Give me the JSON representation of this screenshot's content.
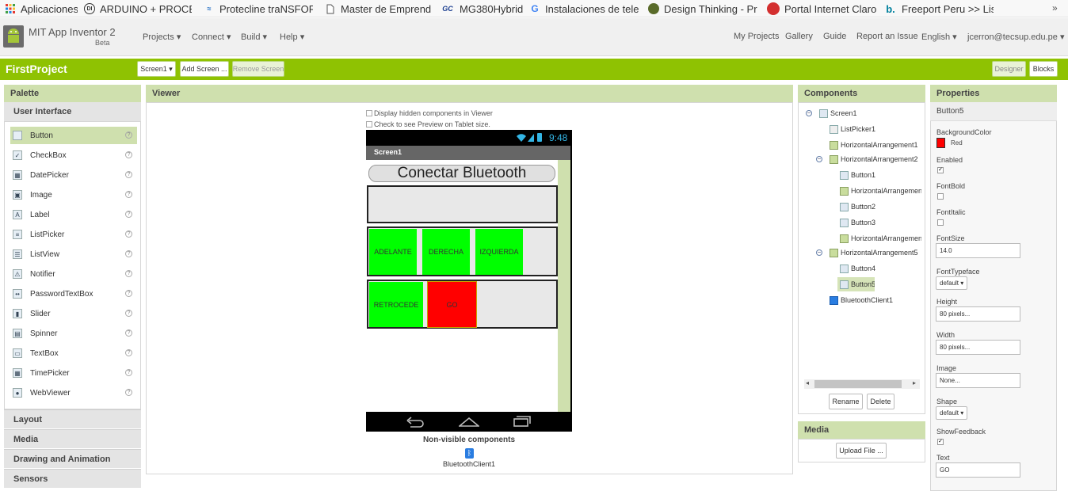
{
  "bookmarks": [
    {
      "label": "Aplicaciones",
      "icon": "apps-grid-icon"
    },
    {
      "label": "ARDUINO + PROCES",
      "icon": "di-logo-icon",
      "badge": "DI"
    },
    {
      "label": "Protecline traNSFORM",
      "icon": "protecline-icon"
    },
    {
      "label": "Master de Emprende",
      "icon": "document-icon"
    },
    {
      "label": "MG380Hybrid",
      "icon": "gc-logo-icon",
      "badge": "GC"
    },
    {
      "label": "Instalaciones de telec",
      "icon": "google-icon",
      "badge": "G"
    },
    {
      "label": "Design Thinking - Pro",
      "icon": "design-thinking-icon"
    },
    {
      "label": "Portal Internet Claro",
      "icon": "claro-icon"
    },
    {
      "label": "Freeport Peru >> List",
      "icon": "bing-icon",
      "badge": "b."
    }
  ],
  "app": {
    "logo_title": "MIT App Inventor 2",
    "logo_subtitle": "Beta",
    "menus": [
      "Projects",
      "Connect",
      "Build",
      "Help"
    ],
    "right_links": [
      "My Projects",
      "Gallery",
      "Guide",
      "Report an Issue",
      "English",
      "jcerron@tecsup.edu.pe"
    ]
  },
  "project": {
    "name": "FirstProject",
    "screen_select": "Screen1",
    "add_screen": "Add Screen ...",
    "remove_screen": "Remove Screen",
    "designer": "Designer",
    "blocks": "Blocks"
  },
  "palette": {
    "title": "Palette",
    "open_category": "User Interface",
    "items": [
      "Button",
      "CheckBox",
      "DatePicker",
      "Image",
      "Label",
      "ListPicker",
      "ListView",
      "Notifier",
      "PasswordTextBox",
      "Slider",
      "Spinner",
      "TextBox",
      "TimePicker",
      "WebViewer"
    ],
    "help_mark": "?",
    "categories": [
      "Layout",
      "Media",
      "Drawing and Animation",
      "Sensors"
    ]
  },
  "viewer": {
    "title": "Viewer",
    "check_hidden": "Display hidden components in Viewer",
    "check_tablet": "Check to see Preview on Tablet size.",
    "time": "9:48",
    "screen_title": "Screen1",
    "connect_button": "Conectar Bluetooth",
    "row1": [
      "ADELANTE",
      "DERECHA",
      "IZQUIERDA"
    ],
    "row2_left": "RETROCEDE",
    "row2_go": "GO",
    "nonvisible_title": "Non-visible components",
    "nonvisible_item": "BluetoothClient1"
  },
  "components": {
    "title": "Components",
    "tree": [
      {
        "label": "Screen1",
        "toggle": "⊖"
      },
      {
        "label": "ListPicker1"
      },
      {
        "label": "HorizontalArrangement1"
      },
      {
        "label": "HorizontalArrangement2",
        "toggle": "⊖"
      },
      {
        "label": "Button1"
      },
      {
        "label": "HorizontalArrangemen"
      },
      {
        "label": "Button2"
      },
      {
        "label": "Button3"
      },
      {
        "label": "HorizontalArrangemen"
      },
      {
        "label": "HorizontalArrangement5",
        "toggle": "⊖"
      },
      {
        "label": "Button4"
      },
      {
        "label": "Button5",
        "selected": true
      },
      {
        "label": "BluetoothClient1"
      }
    ],
    "rename": "Rename",
    "delete": "Delete"
  },
  "media": {
    "title": "Media",
    "upload": "Upload File ..."
  },
  "properties": {
    "title": "Properties",
    "component": "Button5",
    "background_color_label": "BackgroundColor",
    "background_color_value": "Red",
    "background_color_hex": "#ff0000",
    "enabled_label": "Enabled",
    "enabled": true,
    "fontbold_label": "FontBold",
    "fontbold": false,
    "fontitalic_label": "FontItalic",
    "fontitalic": false,
    "fontsize_label": "FontSize",
    "fontsize": "14.0",
    "typeface_label": "FontTypeface",
    "typeface": "default",
    "height_label": "Height",
    "height": "80 pixels...",
    "width_label": "Width",
    "width": "80 pixels...",
    "image_label": "Image",
    "image": "None...",
    "shape_label": "Shape",
    "shape": "default",
    "showfeedback_label": "ShowFeedback",
    "showfeedback": true,
    "text_label": "Text",
    "text": "GO"
  },
  "colors": {
    "accent_green": "#8fc202",
    "panel_header": "#cfe0ae",
    "button_green": "#00ff00",
    "button_red": "#ff0000"
  }
}
